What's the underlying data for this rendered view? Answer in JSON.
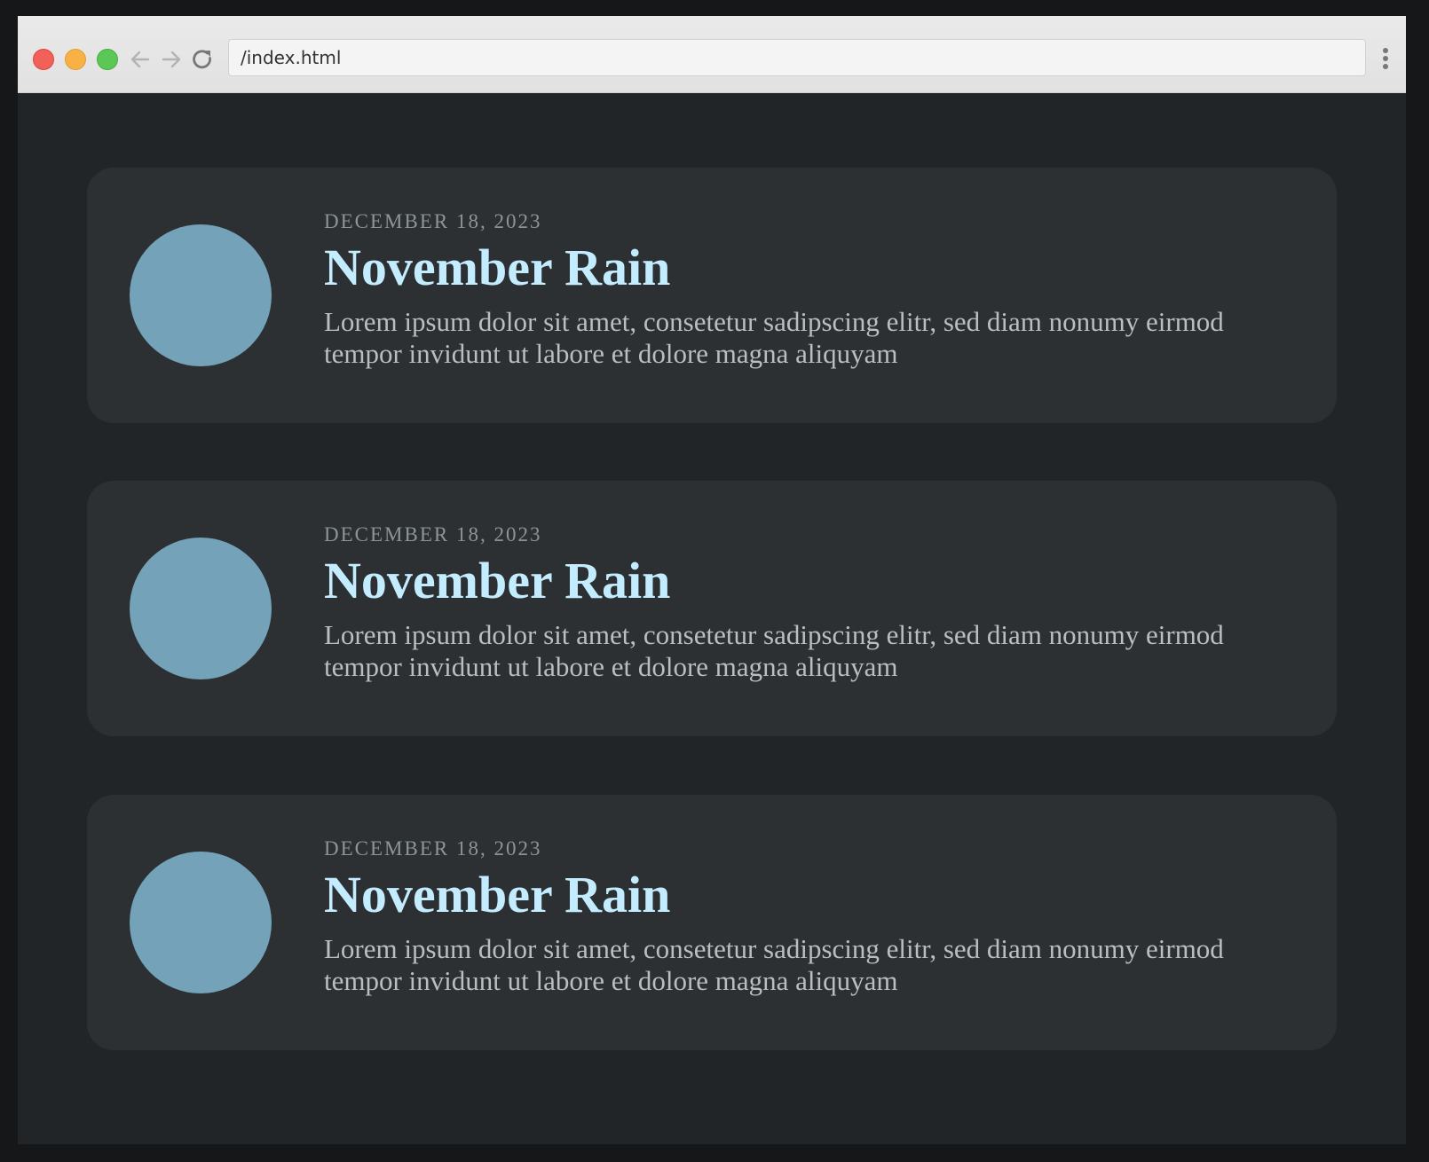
{
  "browser": {
    "url": "/index.html"
  },
  "cards": [
    {
      "date": "DECEMBER 18, 2023",
      "title": "November Rain",
      "body": "Lorem ipsum dolor sit amet, consetetur sadipscing elitr, sed diam nonumy eirmod tempor invidunt ut labore et dolore magna aliquyam"
    },
    {
      "date": "DECEMBER 18, 2023",
      "title": "November Rain",
      "body": "Lorem ipsum dolor sit amet, consetetur sadipscing elitr, sed diam nonumy eirmod tempor invidunt ut labore et dolore magna aliquyam"
    },
    {
      "date": "DECEMBER 18, 2023",
      "title": "November Rain",
      "body": "Lorem ipsum dolor sit amet, consetetur sadipscing elitr, sed diam nonumy eirmod tempor invidunt ut labore et dolore magna aliquyam"
    }
  ],
  "colors": {
    "page_background": "#212528",
    "card_background": "#2c3033",
    "avatar": "#74a2b9",
    "title": "#c4ecff",
    "date": "#8d9497",
    "body": "#b8bec1"
  },
  "icons": {
    "back": "arrow-left-icon",
    "forward": "arrow-right-icon",
    "reload": "reload-icon",
    "menu": "vertical-dots-icon"
  }
}
